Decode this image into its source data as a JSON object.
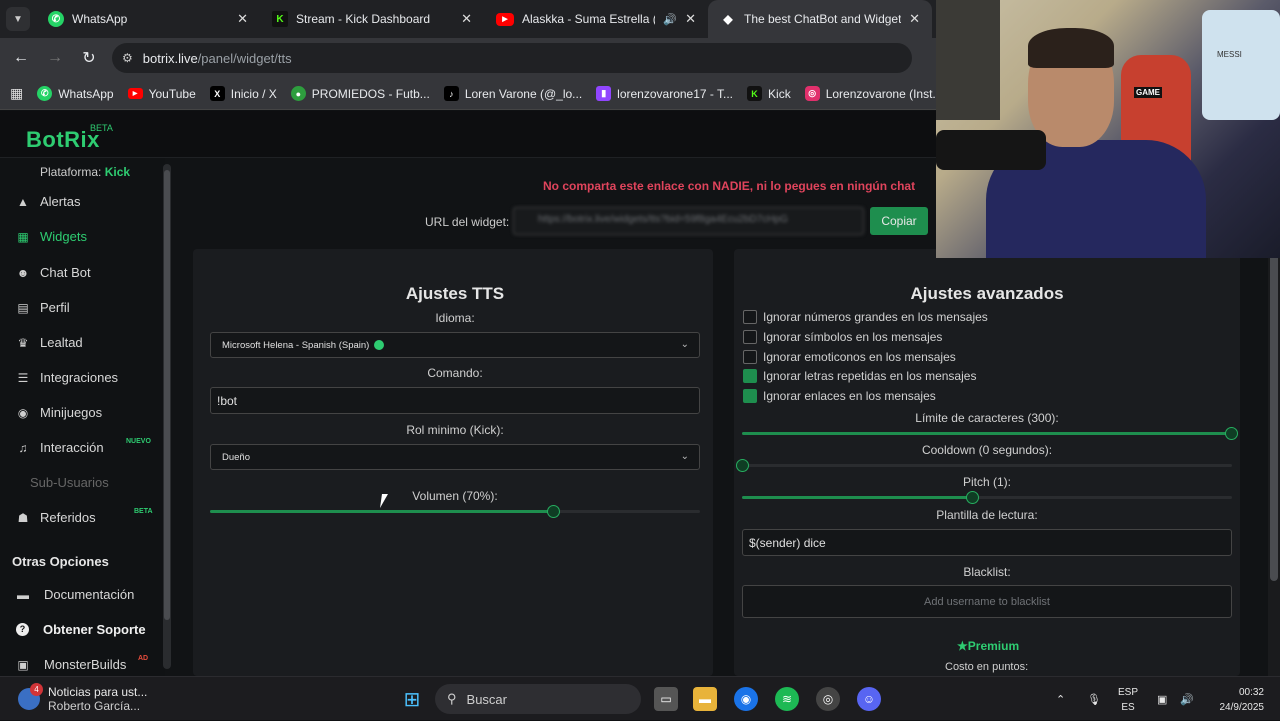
{
  "browser": {
    "tabs": [
      {
        "title": "WhatsApp",
        "icon": "whatsapp-icon",
        "color": "#25d366"
      },
      {
        "title": "Stream - Kick Dashboard",
        "icon": "kick-icon",
        "color": "#53fc18"
      },
      {
        "title": "Alaskka - Suma Estrella (Vid",
        "icon": "youtube-icon",
        "color": "#ff0000"
      },
      {
        "title": "The best ChatBot and Widgets",
        "icon": "botrix-icon",
        "color": "#ffffff"
      }
    ],
    "url_host": "botrix.live",
    "url_path": "/panel/widget/tts",
    "bookmarks": [
      {
        "label": "WhatsApp",
        "icon": "whatsapp-icon",
        "color": "#25d366"
      },
      {
        "label": "YouTube",
        "icon": "youtube-icon",
        "color": "#ff0000"
      },
      {
        "label": "Inicio / X",
        "icon": "x-icon",
        "color": "#000000"
      },
      {
        "label": "PROMIEDOS - Futb...",
        "icon": "promiedos-icon",
        "color": "#2e9e3e"
      },
      {
        "label": "Loren Varone (@_lo...",
        "icon": "tiktok-icon",
        "color": "#000000"
      },
      {
        "label": "lorenzovarone17 - T...",
        "icon": "twitch-icon",
        "color": "#9146ff"
      },
      {
        "label": "Kick",
        "icon": "kick-icon",
        "color": "#53fc18"
      },
      {
        "label": "Lorenzovarone (Inst...",
        "icon": "instagram-icon",
        "color": "#e1306c"
      }
    ]
  },
  "app": {
    "logo": "BotRix",
    "logo_badge": "BETA",
    "platform_label": "Plataforma:",
    "platform_value": "Kick"
  },
  "sidebar": {
    "items": [
      {
        "label": "Alertas",
        "icon": "warning-icon"
      },
      {
        "label": "Widgets",
        "icon": "grid-icon"
      },
      {
        "label": "Chat Bot",
        "icon": "robot-icon"
      },
      {
        "label": "Perfil",
        "icon": "id-card-icon"
      },
      {
        "label": "Lealtad",
        "icon": "trophy-icon"
      },
      {
        "label": "Integraciones",
        "icon": "list-icon"
      },
      {
        "label": "Minijuegos",
        "icon": "gamepad-icon"
      },
      {
        "label": "Interacción",
        "icon": "music-icon",
        "badge": "NUEVO"
      },
      {
        "label": "Sub-Usuarios",
        "icon": "users-icon"
      },
      {
        "label": "Referidos",
        "icon": "users-icon",
        "badge": "BETA"
      }
    ],
    "other_heading": "Otras Opciones",
    "other_items": [
      {
        "label": "Documentación",
        "icon": "book-icon"
      },
      {
        "label": "Obtener Soporte",
        "icon": "help-icon"
      },
      {
        "label": "MonsterBuilds",
        "icon": "monster-icon",
        "badge": "AD"
      }
    ]
  },
  "widget": {
    "warning": "No comparta este enlace con NADIE, ni lo pegues en ningún chat",
    "url_label": "URL del widget:",
    "url_value": "https://botrix.live/widgets/tts?bid=59f8ga4Ecu2bD7cHpG",
    "copy_label": "Copiar"
  },
  "tts": {
    "title": "Ajustes TTS",
    "idioma_label": "Idioma:",
    "idioma_value": "Microsoft Helena - Spanish (Spain)",
    "comando_label": "Comando:",
    "comando_value": "!bot",
    "rol_label": "Rol minimo (Kick):",
    "rol_value": "Dueño",
    "volumen_label": "Volumen (70%):",
    "volumen_level": 0.7
  },
  "advanced": {
    "title": "Ajustes avanzados",
    "checkboxes": [
      {
        "label": "Ignorar números grandes en los mensajes",
        "checked": false
      },
      {
        "label": "Ignorar símbolos en los mensajes",
        "checked": false
      },
      {
        "label": "Ignorar emoticonos en los mensajes",
        "checked": false
      },
      {
        "label": "Ignorar letras repetidas en los mensajes",
        "checked": true
      },
      {
        "label": "Ignorar enlaces en los mensajes",
        "checked": true
      }
    ],
    "limit_label": "Límite de caracteres (300):",
    "limit_level": 1.0,
    "cooldown_label": "Cooldown (0 segundos):",
    "cooldown_level": 0.0,
    "pitch_label": "Pitch (1):",
    "pitch_level": 0.47,
    "template_label": "Plantilla de lectura:",
    "template_value": "$(sender) dice",
    "blacklist_label": "Blacklist:",
    "blacklist_placeholder": "Add username to blacklist",
    "premium_label": "Premium",
    "cost_label": "Costo en puntos:"
  },
  "webcam": {
    "chair_text": "GAME",
    "shirt_text": "MESSI"
  },
  "taskbar": {
    "news_title": "Noticias para ust...",
    "news_sub": "Roberto García...",
    "news_badge": "4",
    "search_placeholder": "Buscar",
    "lang_top": "ESP",
    "lang_bottom": "ES",
    "time": "00:32",
    "date": "24/9/2025"
  },
  "colors": {
    "accent": "#2ecc71",
    "warning": "#e0445c",
    "copy_button": "#1e8e4e"
  }
}
